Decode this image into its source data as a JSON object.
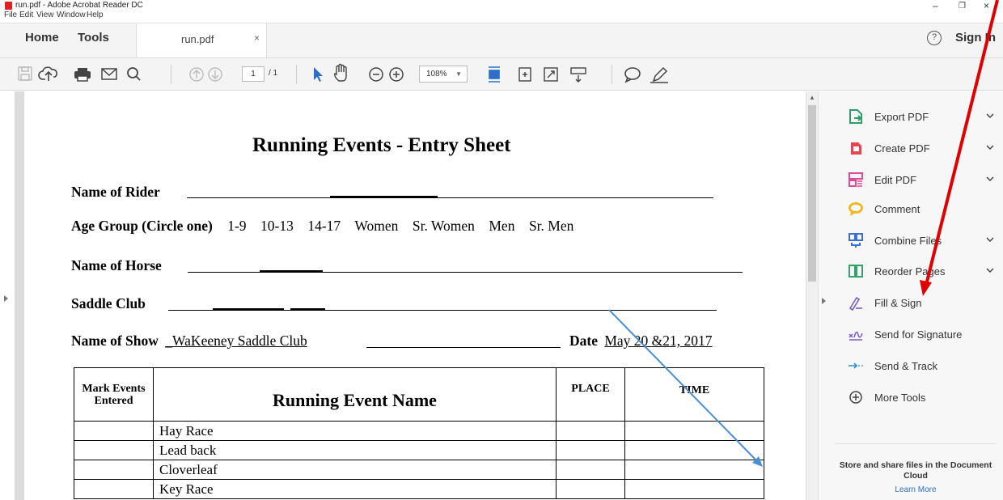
{
  "window": {
    "title": "run.pdf - Adobe Acrobat Reader DC",
    "controls": [
      "–",
      "❐",
      "×"
    ]
  },
  "menu": [
    "File",
    "Edit",
    "View",
    "Window",
    "Help"
  ],
  "tabs": {
    "home": "Home",
    "tools": "Tools",
    "doc_name": "run.pdf",
    "close": "×",
    "help": "?",
    "sign_in": "Sign In"
  },
  "toolbar": {
    "page_current": "1",
    "page_total": "/ 1",
    "zoom": "108%",
    "icons": [
      "save-icon",
      "upload-icon",
      "print-icon",
      "email-icon",
      "search-icon",
      "prev-page-icon",
      "next-page-icon",
      "select-arrow-icon",
      "hand-icon",
      "zoom-out-icon",
      "zoom-in-icon",
      "fit-page-icon",
      "page-icon",
      "fullscreen-icon",
      "scroll-icon",
      "comment-icon",
      "pen-icon"
    ]
  },
  "right_panel": {
    "tools": [
      {
        "label": "Export PDF",
        "icon": "export-pdf-icon",
        "color": "#2e9d6b",
        "expand": true
      },
      {
        "label": "Create PDF",
        "icon": "create-pdf-icon",
        "color": "#e34850",
        "expand": true
      },
      {
        "label": "Edit PDF",
        "icon": "edit-pdf-icon",
        "color": "#e0489a",
        "expand": true
      },
      {
        "label": "Comment",
        "icon": "comment-icon",
        "color": "#f5b623",
        "expand": false
      },
      {
        "label": "Combine Files",
        "icon": "combine-files-icon",
        "color": "#3a6fd8",
        "expand": true
      },
      {
        "label": "Reorder Pages",
        "icon": "reorder-pages-icon",
        "color": "#33a36b",
        "expand": true
      },
      {
        "label": "Fill & Sign",
        "icon": "fill-sign-icon",
        "color": "#7a5bc4",
        "expand": false
      },
      {
        "label": "Send for Signature",
        "icon": "send-signature-icon",
        "color": "#7a5bc4",
        "expand": false
      },
      {
        "label": "Send & Track",
        "icon": "send-track-icon",
        "color": "#2d8fd8",
        "expand": false
      },
      {
        "label": "More Tools",
        "icon": "more-tools-icon",
        "color": "#444444",
        "expand": false
      }
    ],
    "cloud_message": "Store and share files in the Document Cloud",
    "learn_more": "Learn More"
  },
  "document": {
    "title": "Running Events - Entry Sheet",
    "name_of_rider": "Name of Rider",
    "age_group_label": "Age Group (Circle one)",
    "age_groups": "1-9    10-13    14-17    Women    Sr. Women    Men    Sr. Men",
    "name_of_horse": "Name of Horse",
    "saddle_club": "Saddle Club",
    "name_of_show_label": "Name of Show",
    "name_of_show_value": "_WaKeeney Saddle Club",
    "date_label": "Date",
    "date_value": "May 20 &21, 2017",
    "table": {
      "headers": [
        "Mark Events Entered",
        "Running Event Name",
        "PLACE",
        "TIME"
      ],
      "rows": [
        "Hay Race",
        "Lead back",
        "Cloverleaf",
        "Key Race"
      ]
    }
  }
}
